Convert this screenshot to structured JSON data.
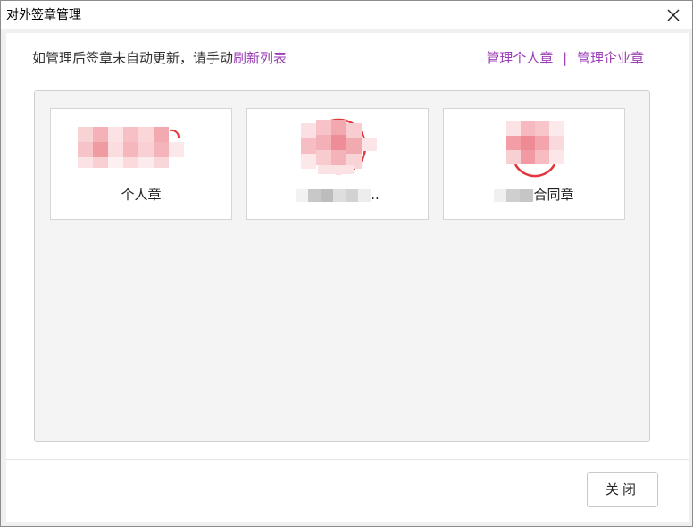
{
  "window": {
    "title": "对外签章管理"
  },
  "notice": {
    "prefix": "如管理后签章未自动更新，请手动",
    "refresh_link": "刷新列表"
  },
  "top_links": {
    "personal": "管理个人章",
    "separator": "|",
    "enterprise": "管理企业章"
  },
  "seals": [
    {
      "label": "个人章"
    },
    {
      "label": ".."
    },
    {
      "label": "合同章"
    }
  ],
  "footer": {
    "close_label": "关闭"
  },
  "colors": {
    "accent_link": "#9b3db5",
    "seal_red": "#e0363c"
  }
}
